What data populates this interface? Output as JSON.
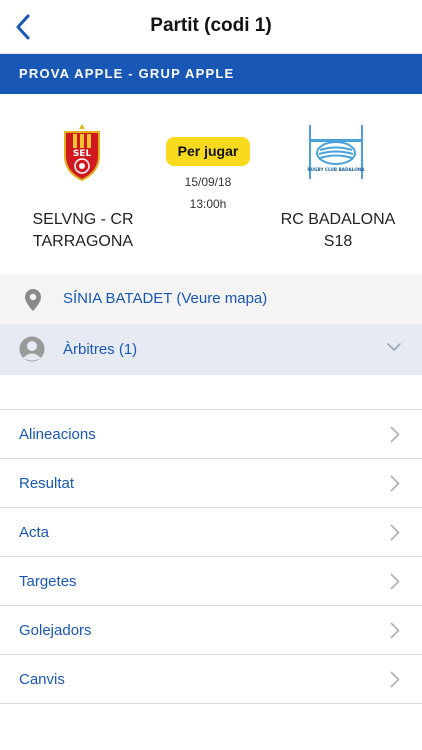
{
  "navbar": {
    "title": "Partit (codi 1)"
  },
  "banner": {
    "text": "PROVA APPLE - GRUP APPLE"
  },
  "match": {
    "status": "Per jugar",
    "date": "15/09/18",
    "time": "13:00h",
    "home_team": {
      "name_line1": "SELVNG - CR",
      "name_line2": "TARRAGONA",
      "logo_text": "SEL"
    },
    "away_team": {
      "name_line1": "RC BADALONA",
      "name_line2": "S18",
      "logo_text": "RUGBY CLUB BADALONA"
    }
  },
  "venue": {
    "label": "SÍNIA BATADET (Veure mapa)"
  },
  "referees": {
    "label": "Àrbitres (1)"
  },
  "menu": [
    {
      "label": "Alineacions"
    },
    {
      "label": "Resultat"
    },
    {
      "label": "Acta"
    },
    {
      "label": "Targetes"
    },
    {
      "label": "Golejadors"
    },
    {
      "label": "Canvis"
    }
  ],
  "colors": {
    "accent": "#1957b7",
    "badge": "#f7da1e",
    "home_red": "#d0191e",
    "away_blue": "#4aa3d8"
  }
}
